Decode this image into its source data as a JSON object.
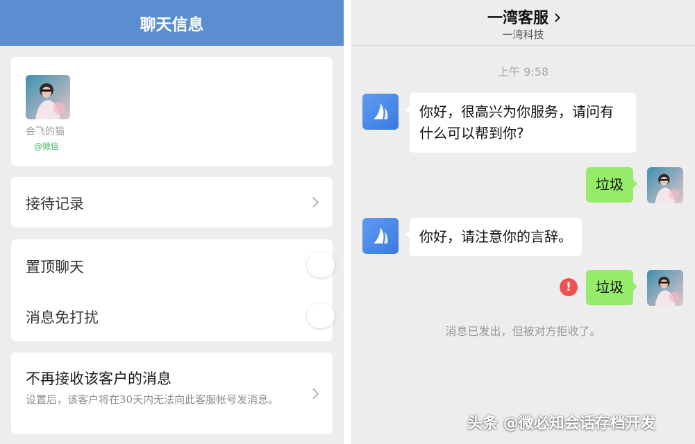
{
  "left_panel": {
    "header_title": "聊天信息",
    "profile": {
      "name": "会飞的猫",
      "source": "@微信"
    },
    "reception_record_label": "接待记录",
    "pin_chat_label": "置顶聊天",
    "mute_label": "消息免打扰",
    "block_title": "不再接收该客户的消息",
    "block_desc": "设置后，该客户将在30天内无法向此客服帐号发消息。",
    "pin_chat_on": false,
    "mute_on": false
  },
  "chat": {
    "title": "一湾客服",
    "subtitle": "一湾科技",
    "timestamp": "上午 9:58",
    "messages": [
      {
        "from": "bot",
        "text": "你好，很高兴为你服务，请问有什么可以帮到你?"
      },
      {
        "from": "user",
        "text": "垃圾"
      },
      {
        "from": "bot",
        "text": "你好，请注意你的言辞。"
      },
      {
        "from": "user",
        "text": "垃圾",
        "status_icon": "!"
      }
    ],
    "notice": "消息已发出，但被对方拒收了。"
  },
  "watermark": "头条 @微必知会话存档开发",
  "colors": {
    "header_blue": "#5b8ed0",
    "bubble_green": "#95ec69",
    "error_red": "#f25151",
    "source_green": "#3fb96a"
  },
  "icons": {
    "bot_avatar": "sail-logo-icon",
    "user_avatar": "user-photo-avatar",
    "chevron": "chevron-right-icon",
    "error": "error-icon"
  }
}
